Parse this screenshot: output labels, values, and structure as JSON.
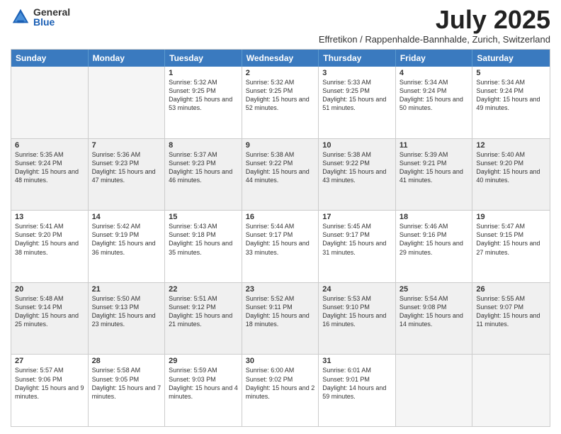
{
  "logo": {
    "general": "General",
    "blue": "Blue"
  },
  "title": "July 2025",
  "subtitle": "Effretikon / Rappenhalde-Bannhalde, Zurich, Switzerland",
  "days": [
    "Sunday",
    "Monday",
    "Tuesday",
    "Wednesday",
    "Thursday",
    "Friday",
    "Saturday"
  ],
  "rows": [
    [
      {
        "day": "",
        "empty": true
      },
      {
        "day": "",
        "empty": true
      },
      {
        "day": "1",
        "sunrise": "Sunrise: 5:32 AM",
        "sunset": "Sunset: 9:25 PM",
        "daylight": "Daylight: 15 hours and 53 minutes."
      },
      {
        "day": "2",
        "sunrise": "Sunrise: 5:32 AM",
        "sunset": "Sunset: 9:25 PM",
        "daylight": "Daylight: 15 hours and 52 minutes."
      },
      {
        "day": "3",
        "sunrise": "Sunrise: 5:33 AM",
        "sunset": "Sunset: 9:25 PM",
        "daylight": "Daylight: 15 hours and 51 minutes."
      },
      {
        "day": "4",
        "sunrise": "Sunrise: 5:34 AM",
        "sunset": "Sunset: 9:24 PM",
        "daylight": "Daylight: 15 hours and 50 minutes."
      },
      {
        "day": "5",
        "sunrise": "Sunrise: 5:34 AM",
        "sunset": "Sunset: 9:24 PM",
        "daylight": "Daylight: 15 hours and 49 minutes."
      }
    ],
    [
      {
        "day": "6",
        "sunrise": "Sunrise: 5:35 AM",
        "sunset": "Sunset: 9:24 PM",
        "daylight": "Daylight: 15 hours and 48 minutes.",
        "shaded": true
      },
      {
        "day": "7",
        "sunrise": "Sunrise: 5:36 AM",
        "sunset": "Sunset: 9:23 PM",
        "daylight": "Daylight: 15 hours and 47 minutes.",
        "shaded": true
      },
      {
        "day": "8",
        "sunrise": "Sunrise: 5:37 AM",
        "sunset": "Sunset: 9:23 PM",
        "daylight": "Daylight: 15 hours and 46 minutes.",
        "shaded": true
      },
      {
        "day": "9",
        "sunrise": "Sunrise: 5:38 AM",
        "sunset": "Sunset: 9:22 PM",
        "daylight": "Daylight: 15 hours and 44 minutes.",
        "shaded": true
      },
      {
        "day": "10",
        "sunrise": "Sunrise: 5:38 AM",
        "sunset": "Sunset: 9:22 PM",
        "daylight": "Daylight: 15 hours and 43 minutes.",
        "shaded": true
      },
      {
        "day": "11",
        "sunrise": "Sunrise: 5:39 AM",
        "sunset": "Sunset: 9:21 PM",
        "daylight": "Daylight: 15 hours and 41 minutes.",
        "shaded": true
      },
      {
        "day": "12",
        "sunrise": "Sunrise: 5:40 AM",
        "sunset": "Sunset: 9:20 PM",
        "daylight": "Daylight: 15 hours and 40 minutes.",
        "shaded": true
      }
    ],
    [
      {
        "day": "13",
        "sunrise": "Sunrise: 5:41 AM",
        "sunset": "Sunset: 9:20 PM",
        "daylight": "Daylight: 15 hours and 38 minutes."
      },
      {
        "day": "14",
        "sunrise": "Sunrise: 5:42 AM",
        "sunset": "Sunset: 9:19 PM",
        "daylight": "Daylight: 15 hours and 36 minutes."
      },
      {
        "day": "15",
        "sunrise": "Sunrise: 5:43 AM",
        "sunset": "Sunset: 9:18 PM",
        "daylight": "Daylight: 15 hours and 35 minutes."
      },
      {
        "day": "16",
        "sunrise": "Sunrise: 5:44 AM",
        "sunset": "Sunset: 9:17 PM",
        "daylight": "Daylight: 15 hours and 33 minutes."
      },
      {
        "day": "17",
        "sunrise": "Sunrise: 5:45 AM",
        "sunset": "Sunset: 9:17 PM",
        "daylight": "Daylight: 15 hours and 31 minutes."
      },
      {
        "day": "18",
        "sunrise": "Sunrise: 5:46 AM",
        "sunset": "Sunset: 9:16 PM",
        "daylight": "Daylight: 15 hours and 29 minutes."
      },
      {
        "day": "19",
        "sunrise": "Sunrise: 5:47 AM",
        "sunset": "Sunset: 9:15 PM",
        "daylight": "Daylight: 15 hours and 27 minutes."
      }
    ],
    [
      {
        "day": "20",
        "sunrise": "Sunrise: 5:48 AM",
        "sunset": "Sunset: 9:14 PM",
        "daylight": "Daylight: 15 hours and 25 minutes.",
        "shaded": true
      },
      {
        "day": "21",
        "sunrise": "Sunrise: 5:50 AM",
        "sunset": "Sunset: 9:13 PM",
        "daylight": "Daylight: 15 hours and 23 minutes.",
        "shaded": true
      },
      {
        "day": "22",
        "sunrise": "Sunrise: 5:51 AM",
        "sunset": "Sunset: 9:12 PM",
        "daylight": "Daylight: 15 hours and 21 minutes.",
        "shaded": true
      },
      {
        "day": "23",
        "sunrise": "Sunrise: 5:52 AM",
        "sunset": "Sunset: 9:11 PM",
        "daylight": "Daylight: 15 hours and 18 minutes.",
        "shaded": true
      },
      {
        "day": "24",
        "sunrise": "Sunrise: 5:53 AM",
        "sunset": "Sunset: 9:10 PM",
        "daylight": "Daylight: 15 hours and 16 minutes.",
        "shaded": true
      },
      {
        "day": "25",
        "sunrise": "Sunrise: 5:54 AM",
        "sunset": "Sunset: 9:08 PM",
        "daylight": "Daylight: 15 hours and 14 minutes.",
        "shaded": true
      },
      {
        "day": "26",
        "sunrise": "Sunrise: 5:55 AM",
        "sunset": "Sunset: 9:07 PM",
        "daylight": "Daylight: 15 hours and 11 minutes.",
        "shaded": true
      }
    ],
    [
      {
        "day": "27",
        "sunrise": "Sunrise: 5:57 AM",
        "sunset": "Sunset: 9:06 PM",
        "daylight": "Daylight: 15 hours and 9 minutes."
      },
      {
        "day": "28",
        "sunrise": "Sunrise: 5:58 AM",
        "sunset": "Sunset: 9:05 PM",
        "daylight": "Daylight: 15 hours and 7 minutes."
      },
      {
        "day": "29",
        "sunrise": "Sunrise: 5:59 AM",
        "sunset": "Sunset: 9:03 PM",
        "daylight": "Daylight: 15 hours and 4 minutes."
      },
      {
        "day": "30",
        "sunrise": "Sunrise: 6:00 AM",
        "sunset": "Sunset: 9:02 PM",
        "daylight": "Daylight: 15 hours and 2 minutes."
      },
      {
        "day": "31",
        "sunrise": "Sunrise: 6:01 AM",
        "sunset": "Sunset: 9:01 PM",
        "daylight": "Daylight: 14 hours and 59 minutes."
      },
      {
        "day": "",
        "empty": true
      },
      {
        "day": "",
        "empty": true
      }
    ]
  ]
}
